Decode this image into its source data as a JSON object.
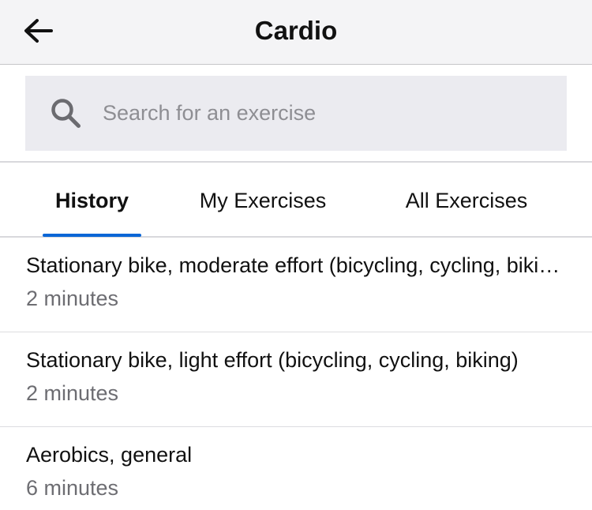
{
  "header": {
    "title": "Cardio",
    "back_icon": "arrow-left-icon"
  },
  "search": {
    "placeholder": "Search for an exercise",
    "value": "",
    "icon": "search-icon"
  },
  "tabs": [
    {
      "label": "History",
      "active": true
    },
    {
      "label": "My Exercises",
      "active": false
    },
    {
      "label": "All Exercises",
      "active": false
    }
  ],
  "history": [
    {
      "title": "Stationary bike, moderate effort (bicycling, cycling, biking)",
      "duration": "2 minutes"
    },
    {
      "title": "Stationary bike, light effort (bicycling, cycling, biking)",
      "duration": "2 minutes"
    },
    {
      "title": "Aerobics, general",
      "duration": "6 minutes"
    }
  ],
  "colors": {
    "accent": "#0a66d6",
    "header_bg": "#f4f4f6",
    "search_bg": "#ebebf0",
    "subtext": "#6d6d72"
  }
}
